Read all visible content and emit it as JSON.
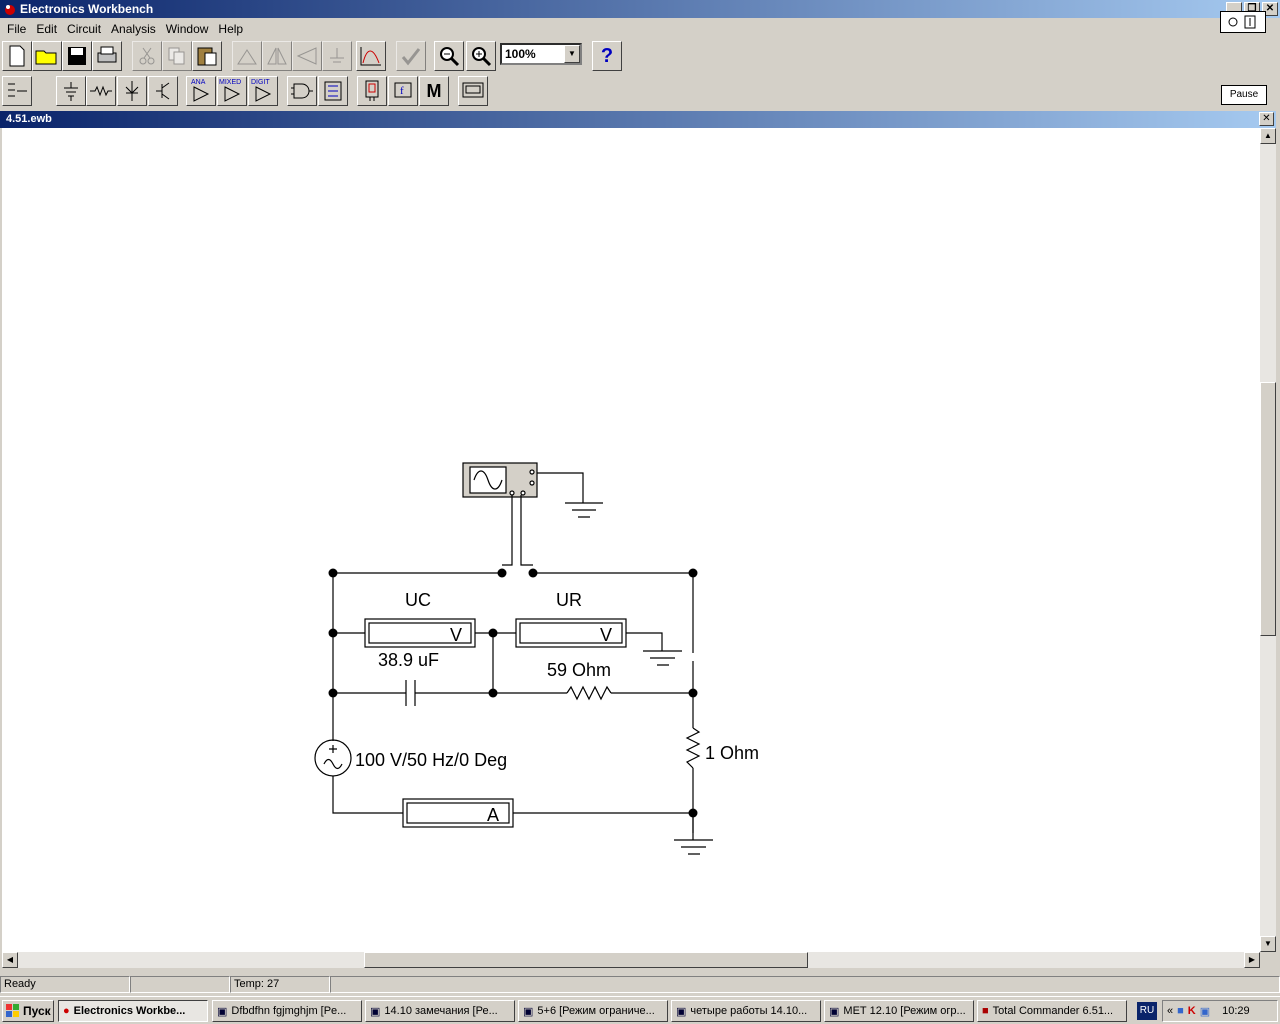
{
  "window": {
    "title": "Electronics Workbench",
    "min": "_",
    "restore": "❐",
    "close": "✕"
  },
  "menu": [
    "File",
    "Edit",
    "Circuit",
    "Analysis",
    "Window",
    "Help"
  ],
  "toolbar": {
    "zoom": "100%",
    "help": "?",
    "pause": "Pause",
    "labels": {
      "ana": "ANA",
      "mixed": "MIXED",
      "digit": "DIGIT",
      "m": "M",
      "f": "f"
    }
  },
  "document": {
    "title": "4.51.ewb"
  },
  "circuit": {
    "uc_label": "UC",
    "ur_label": "UR",
    "voltmeter_symbol": "V",
    "ammeter_symbol": "A",
    "capacitor": "38.9 uF",
    "resistor_top": "59  Ohm",
    "resistor_right": "1  Ohm",
    "source": "100 V/50 Hz/0 Deg"
  },
  "status": {
    "state": "Ready",
    "blank": "",
    "temp": "Temp:  27"
  },
  "taskbar": {
    "start": "Пуск",
    "tasks": [
      "Electronics Workbe...",
      "Dfbdfhn fgjmghjm [Pe...",
      "14.10 замечания [Ре...",
      "5+6 [Режим ограниче...",
      "четыре работы 14.10...",
      "МЕТ 12.10 [Режим огр...",
      "Total Commander 6.51..."
    ],
    "lang": "RU",
    "tray_arrows": "«",
    "clock": "10:29"
  }
}
